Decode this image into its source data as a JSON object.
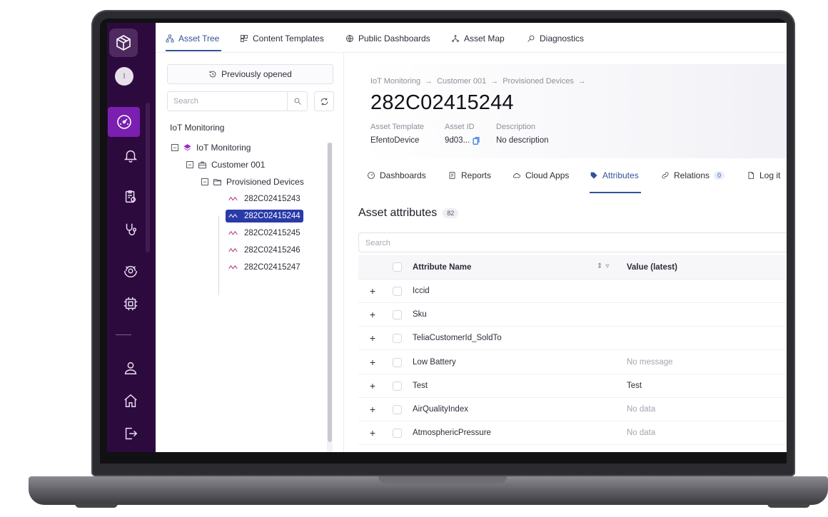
{
  "app": {
    "rail": {
      "avatar_initial": "I",
      "icons": [
        "cube-logo-icon",
        "speedometer-icon",
        "bell-icon",
        "clipboard-gear-icon",
        "stethoscope-icon",
        "satellite-icon",
        "chip-icon",
        "user-icon",
        "home-icon",
        "logout-icon"
      ]
    },
    "topnav": [
      {
        "label": "Asset Tree",
        "icon": "sitemap-icon",
        "active": true
      },
      {
        "label": "Content Templates",
        "icon": "template-icon",
        "active": false
      },
      {
        "label": "Public Dashboards",
        "icon": "globe-icon",
        "active": false
      },
      {
        "label": "Asset Map",
        "icon": "network-icon",
        "active": false
      },
      {
        "label": "Diagnostics",
        "icon": "magnifier-icon",
        "active": false
      }
    ],
    "tree": {
      "previously_opened": "Previously opened",
      "search_placeholder": "Search",
      "title": "IoT Monitoring",
      "nodes": [
        {
          "label": "IoT Monitoring"
        },
        {
          "label": "Customer 001"
        },
        {
          "label": "Provisioned Devices"
        }
      ],
      "leaves": [
        "282C02415243",
        "282C02415244",
        "282C02415245",
        "282C02415246",
        "282C02415247"
      ],
      "selected_leaf": "282C02415244"
    },
    "asset": {
      "breadcrumb": [
        "IoT Monitoring",
        "→",
        "Customer 001",
        "→",
        "Provisioned Devices",
        "→"
      ],
      "title": "282C02415244",
      "template_label": "Asset Template",
      "template_value": "EfentoDevice",
      "id_label": "Asset ID",
      "id_value": "9d03...",
      "description_label": "Description",
      "description_value": "No description"
    },
    "tabs": [
      {
        "label": "Dashboards",
        "icon": "dashboard-icon"
      },
      {
        "label": "Reports",
        "icon": "report-icon"
      },
      {
        "label": "Cloud Apps",
        "icon": "cloud-icon"
      },
      {
        "label": "Attributes",
        "icon": "tag-icon",
        "active": true
      },
      {
        "label": "Relations",
        "icon": "link-icon",
        "count": "0"
      },
      {
        "label": "Log it",
        "icon": "file-icon"
      }
    ],
    "attributes": {
      "section_title": "Asset attributes",
      "count": "82",
      "search_placeholder": "Search",
      "col_name": "Attribute Name",
      "col_value": "Value (latest)",
      "rows": [
        {
          "name": "Iccid",
          "value": ""
        },
        {
          "name": "Sku",
          "value": ""
        },
        {
          "name": "TeliaCustomerId_SoldTo",
          "value": ""
        },
        {
          "name": "Low Battery",
          "value": "No message",
          "muted": true
        },
        {
          "name": "Test",
          "value": "Test",
          "muted": false
        },
        {
          "name": "AirQualityIndex",
          "value": "No data",
          "muted": true
        },
        {
          "name": "AtmosphericPressure",
          "value": "No data",
          "muted": true
        }
      ]
    }
  },
  "colors": {
    "rail_bg": "#2d0a3e",
    "rail_active": "#7a1fb0",
    "accent": "#2f5597",
    "selected_leaf_bg": "#2a3aa8",
    "device_icon": "#b0247a"
  }
}
